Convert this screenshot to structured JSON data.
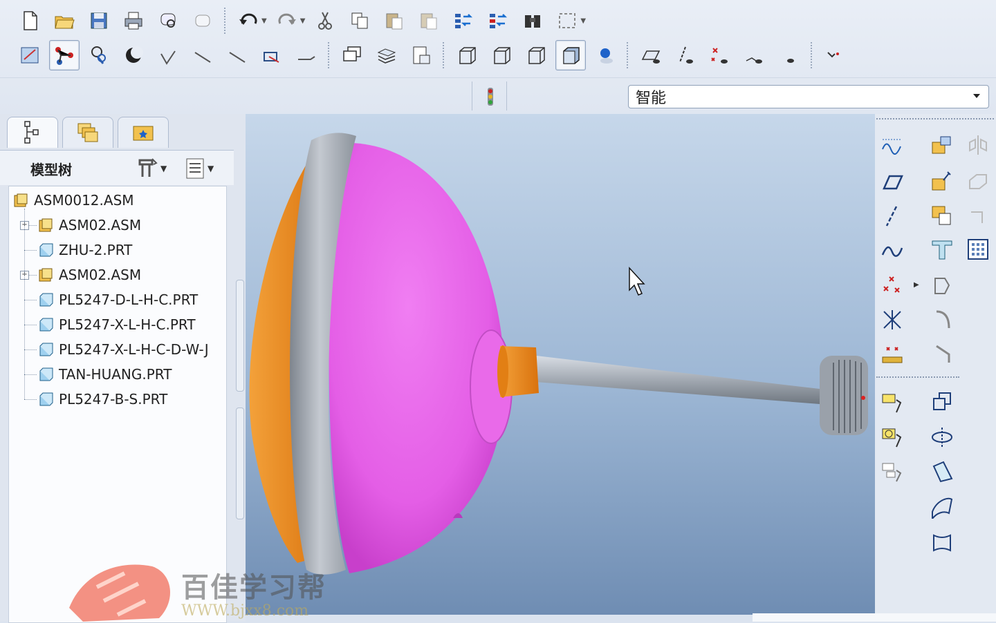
{
  "toolbar": {
    "row1": [
      "new-file",
      "open-file",
      "save",
      "print",
      "print-preview",
      "email",
      "undo",
      "redo",
      "cut",
      "copy",
      "paste",
      "paste-special",
      "regenerate",
      "regenerate-manager",
      "find",
      "select-box"
    ],
    "row2": [
      "repaint",
      "datum-display",
      "appearance",
      "shading",
      "orient-1",
      "orient-2",
      "orient-3",
      "orient-4",
      "saved-views",
      "layers",
      "view-manager",
      "wireframe",
      "hidden-line",
      "no-hidden",
      "shaded",
      "enhanced-realism",
      "plane-display",
      "axis-display",
      "point-display",
      "csys-display",
      "annotation-display",
      "spin-center"
    ],
    "filter": {
      "value": "智能"
    }
  },
  "left_panel": {
    "tabs": [
      "model-tree-tab",
      "folder-browser-tab",
      "favorites-tab"
    ],
    "header": {
      "title": "模型树"
    },
    "tree": [
      {
        "label": "ASM0012.ASM",
        "type": "asm",
        "level": 0,
        "expandable": false
      },
      {
        "label": "ASM02.ASM",
        "type": "asm",
        "level": 1,
        "expandable": true
      },
      {
        "label": "ZHU-2.PRT",
        "type": "prt",
        "level": 1,
        "expandable": false
      },
      {
        "label": "ASM02.ASM",
        "type": "asm",
        "level": 1,
        "expandable": true
      },
      {
        "label": "PL5247-D-L-H-C.PRT",
        "type": "prt",
        "level": 1,
        "expandable": false
      },
      {
        "label": "PL5247-X-L-H-C.PRT",
        "type": "prt",
        "level": 1,
        "expandable": false
      },
      {
        "label": "PL5247-X-L-H-C-D-W-J",
        "type": "prt",
        "level": 1,
        "expandable": false
      },
      {
        "label": "TAN-HUANG.PRT",
        "type": "prt",
        "level": 1,
        "expandable": false
      },
      {
        "label": "PL5247-B-S.PRT",
        "type": "prt",
        "level": 1,
        "expandable": false
      }
    ]
  },
  "right_toolbar": {
    "col1": [
      "sketch-icon",
      "plane-icon",
      "axis-icon",
      "curve-icon",
      "point-icon",
      "csys-icon",
      "analysis-icon",
      "component-icon",
      "component-2-icon",
      "component-3-icon"
    ],
    "col2": [
      "assemble-icon",
      "create-comp-icon",
      "package-icon",
      "layout-icon",
      "shell-icon",
      "round-icon",
      "chamfer-icon",
      "pattern-icon",
      "revolve-icon",
      "draft-icon",
      "surface-icon",
      "boundary-icon"
    ],
    "col3": [
      "mirror-icon",
      "copy-icon",
      "merge-icon",
      "grid-icon"
    ]
  },
  "colors": {
    "body": "#e55fe8",
    "rim": "#9aa0a8",
    "orange": "#f08a1c",
    "viewport_top": "#c6d7ea",
    "viewport_bottom": "#6f8db3"
  },
  "watermark": {
    "title": "百佳学习帮",
    "url": "WWW.bjxx8.com"
  }
}
